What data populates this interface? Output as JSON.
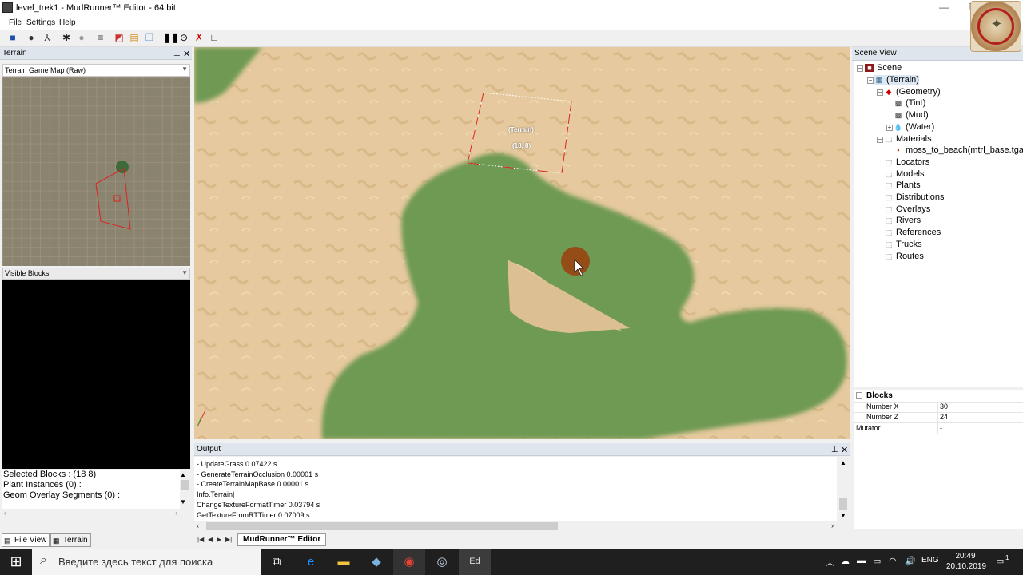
{
  "window": {
    "title": "level_trek1 - MudRunner™ Editor - 64 bit",
    "minimize": "—",
    "maximize": "☐"
  },
  "menu": [
    "File",
    "Settings",
    "Help"
  ],
  "terrain_panel": {
    "title": "Terrain",
    "map_select": "Terrain Game Map (Raw)",
    "visible_blocks_select": "Visible Blocks",
    "info_lines": [
      "Selected Blocks : (18 8)",
      "Plant Instances (0) :",
      "",
      "Geom Overlay Segments (0) :"
    ]
  },
  "bottom_tabs": [
    "File View",
    "Terrain"
  ],
  "viewport": {
    "selection_label": "(Terrain)",
    "selection_coords": "(18, 8)"
  },
  "output": {
    "title": "Output",
    "lines": [
      " - UpdateGrass 0.07422 s",
      " - GenerateTerrainOcclusion 0.00001 s",
      " - CreateTerrainMapBase 0.00001 s",
      "Info.Terrain|",
      "ChangeTextureFormatTimer 0.03794 s",
      "GetTextureFromRTTimer 0.07009 s"
    ]
  },
  "document_tab": "MudRunner™ Editor",
  "scene_view": {
    "title": "Scene View",
    "tree": [
      {
        "label": "Scene",
        "level": 0
      },
      {
        "label": "(Terrain)",
        "level": 1
      },
      {
        "label": "(Geometry)",
        "level": 2
      },
      {
        "label": "(Tint)",
        "level": 3
      },
      {
        "label": "(Mud)",
        "level": 3
      },
      {
        "label": "(Water)",
        "level": 3
      },
      {
        "label": "Materials",
        "level": 2
      },
      {
        "label": "moss_to_beach(mtrl_base.tga)",
        "level": 3
      },
      {
        "label": "Locators",
        "level": 2
      },
      {
        "label": "Models",
        "level": 2
      },
      {
        "label": "Plants",
        "level": 2
      },
      {
        "label": "Distributions",
        "level": 2
      },
      {
        "label": "Overlays",
        "level": 2
      },
      {
        "label": "Rivers",
        "level": 2
      },
      {
        "label": "References",
        "level": 2
      },
      {
        "label": "Trucks",
        "level": 2
      },
      {
        "label": "Routes",
        "level": 2
      }
    ]
  },
  "properties": {
    "section": "Blocks",
    "rows": [
      {
        "name": "Number X",
        "value": "30"
      },
      {
        "name": "Number Z",
        "value": "24"
      },
      {
        "name": "Mutator",
        "value": "-"
      }
    ]
  },
  "taskbar": {
    "search_placeholder": "Введите здесь текст для поиска",
    "language": "ENG",
    "time": "20:49",
    "date": "20.10.2019",
    "notifications": "1"
  }
}
